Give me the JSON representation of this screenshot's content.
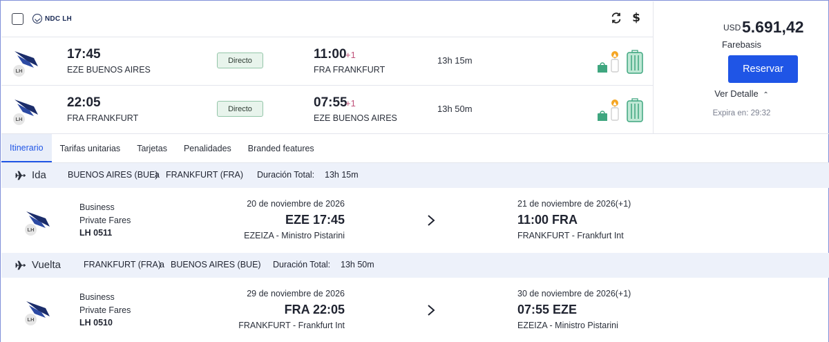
{
  "header": {
    "provider_label": "NDC LH",
    "icons": [
      "checkbox-icon",
      "ndc-logo-icon",
      "refresh-icon",
      "dollar-icon"
    ]
  },
  "flights": [
    {
      "airline_code": "LH",
      "dep_time": "17:45",
      "dep_city": "EZE BUENOS AIRES",
      "stop_label": "Directo",
      "arr_time": "11:00",
      "arr_offset": "+1",
      "arr_city": "FRA FRANKFURT",
      "duration": "13h 15m"
    },
    {
      "airline_code": "LH",
      "dep_time": "22:05",
      "dep_city": "FRA FRANKFURT",
      "stop_label": "Directo",
      "arr_time": "07:55",
      "arr_offset": "+1",
      "arr_city": "EZE BUENOS AIRES",
      "duration": "13h 50m"
    }
  ],
  "price": {
    "currency": "USD",
    "amount": "5.691,42",
    "fare_basis": "Farebasis",
    "book_label": "Reservar",
    "detail_label": "Ver Detalle",
    "expires": "Expira en: 29:32"
  },
  "tabs": [
    {
      "label": "Itinerario",
      "active": true
    },
    {
      "label": "Tarifas unitarias"
    },
    {
      "label": "Tarjetas"
    },
    {
      "label": "Penalidades"
    },
    {
      "label": "Branded features"
    }
  ],
  "legs": [
    {
      "title": "Ida",
      "origin": "BUENOS AIRES (BUE)",
      "connector": "a",
      "destination": "FRANKFURT (FRA)",
      "duration_label": "Duración Total:",
      "duration": "13h 15m",
      "segment": {
        "airline_code": "LH",
        "cabin": "Business",
        "fare": "Private Fares",
        "flight_no": "LH 0511",
        "dep_date": "20 de noviembre de 2026",
        "dep_time_place": "EZE 17:45",
        "dep_airport": "EZEIZA - Ministro Pistarini",
        "arr_date": "21 de noviembre de 2026(+1)",
        "arr_time_place": "11:00 FRA",
        "arr_airport": "FRANKFURT - Frankfurt Int"
      }
    },
    {
      "title": "Vuelta",
      "origin": "FRANKFURT (FRA)",
      "connector": "a",
      "destination": "BUENOS AIRES (BUE)",
      "duration_label": "Duración Total:",
      "duration": "13h 50m",
      "segment": {
        "airline_code": "LH",
        "cabin": "Business",
        "fare": "Private Fares",
        "flight_no": "LH 0510",
        "dep_date": "29 de noviembre de 2026",
        "dep_time_place": "FRA 22:05",
        "dep_airport": "FRANKFURT - Frankfurt Int",
        "arr_date": "30 de noviembre de 2026(+1)",
        "arr_time_place": "07:55 EZE",
        "arr_airport": "EZEIZA - Ministro Pistarini"
      }
    }
  ],
  "colors": {
    "accent": "#1f55e6",
    "direct_bg": "#e8f4ec",
    "direct_border": "#93c5a8",
    "plus_day": "#c0527a",
    "section_bg": "#edf1fa",
    "baggage": "#3fa67f",
    "alert": "#f5a623"
  }
}
